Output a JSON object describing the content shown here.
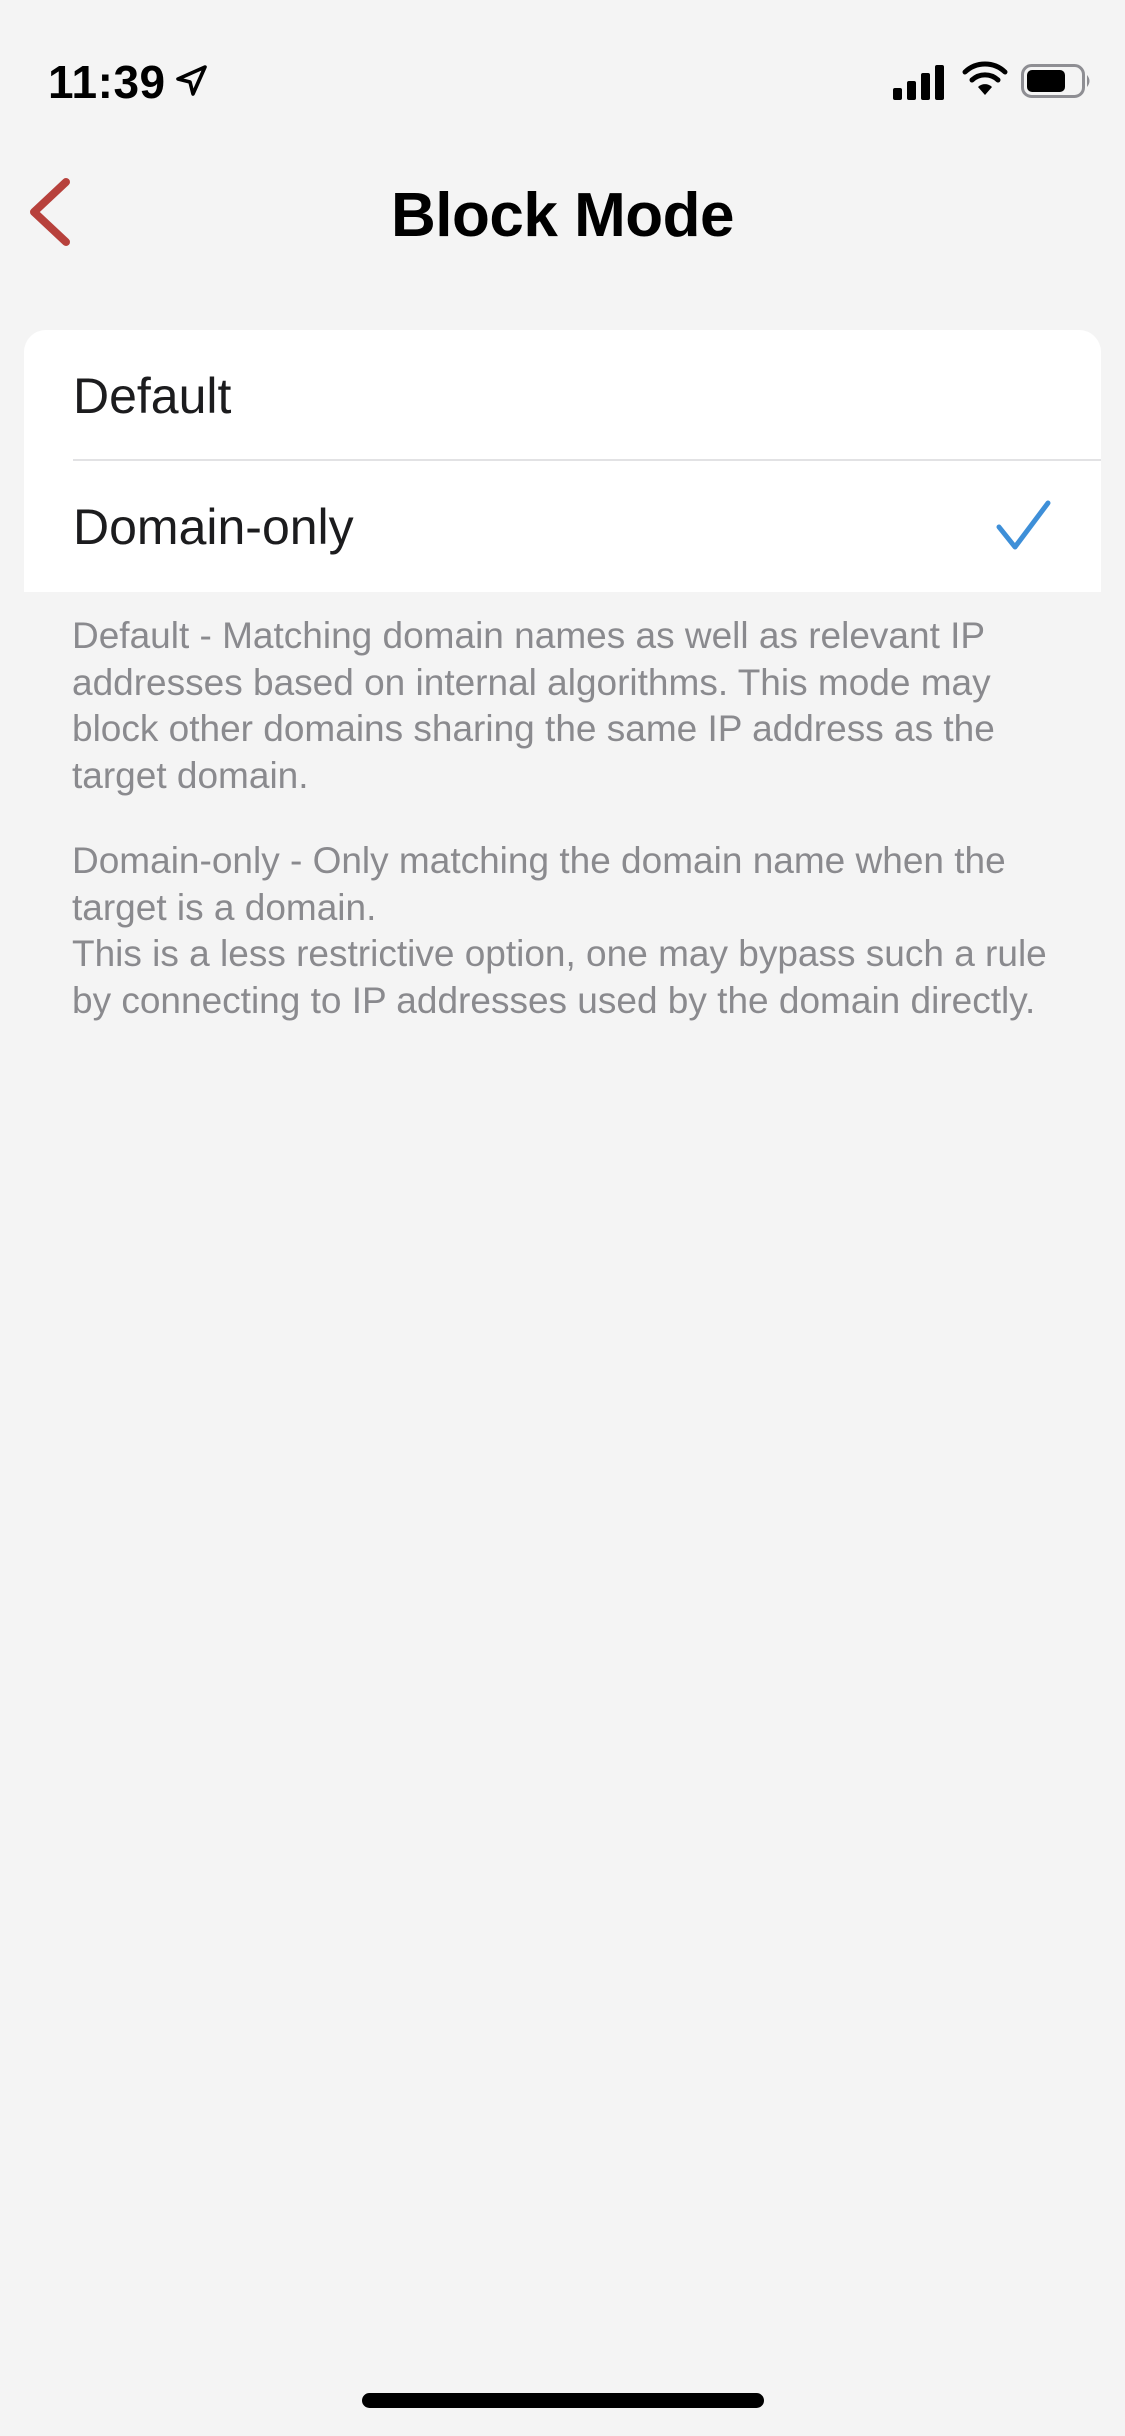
{
  "status_bar": {
    "time": "11:39",
    "icons": [
      "location-arrow-icon",
      "cellular-signal-icon",
      "wifi-icon",
      "battery-icon"
    ]
  },
  "nav": {
    "back_icon": "chevron-left-icon",
    "title": "Block Mode"
  },
  "options": [
    {
      "label": "Default",
      "selected": false
    },
    {
      "label": "Domain-only",
      "selected": true
    }
  ],
  "descriptions": {
    "default": "Default - Matching domain names as well as relevant IP addresses based on internal algorithms. This mode may block other domains sharing the same IP address as the target domain.",
    "domain_only_line1": "Domain-only - Only matching the domain name when the target is a domain.",
    "domain_only_line2": "This is a less restrictive option, one may bypass such a rule by connecting to IP addresses used by the domain directly."
  },
  "colors": {
    "accent_back": "#b7413c",
    "checkmark": "#3e8fd8",
    "background": "#f4f4f4",
    "secondary_text": "#8a8a8e"
  }
}
